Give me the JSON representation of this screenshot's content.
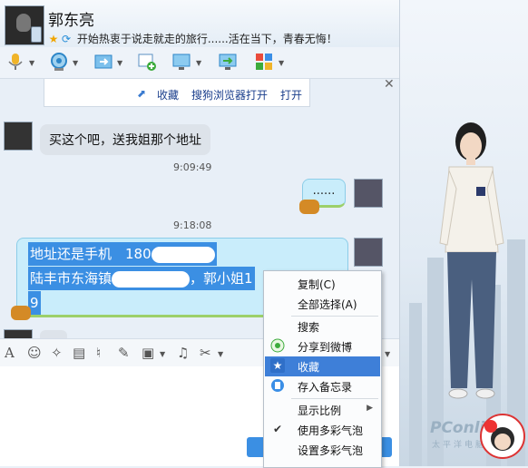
{
  "window": {
    "contact_name": "郭东亮",
    "signature": "开始热衷于说走就走的旅行......活在当下，青春无悔！",
    "controls": "— ☐ ✕"
  },
  "toolbar": {
    "icons": [
      "microphone-icon",
      "video-camera-icon",
      "send-file-icon",
      "create-discussion-icon",
      "remote-desktop-icon",
      "share-screen-icon",
      "app-grid-icon"
    ]
  },
  "link_bar": {
    "favorite": "收藏",
    "open_with_browser": "搜狗浏览器打开",
    "open": "打开"
  },
  "messages": {
    "m1_text": "买这个吧，送我姐那个地址",
    "time1": "9:09:49",
    "m2_text": "......",
    "time2": "9:18:08",
    "m3_line1": "地址还是手机　180",
    "m3_line2a": "陆丰市东海镇",
    "m3_line2b": "，郭小姐1",
    "m3_line3": "9"
  },
  "input_toolbar": {
    "icons": [
      "font-icon",
      "emoji-icon",
      "magic-wand-icon",
      "gif-icon",
      "voice-message-icon",
      "draw-icon",
      "image-icon",
      "music-icon",
      "screenshot-scissors-icon"
    ]
  },
  "context_menu": {
    "items": [
      {
        "label": "复制(C)"
      },
      {
        "label": "全部选择(A)"
      },
      {
        "label": "搜索"
      },
      {
        "label": "分享到微博"
      },
      {
        "label": "收藏"
      },
      {
        "label": "存入备忘录"
      },
      {
        "label": "显示比例"
      },
      {
        "label": "使用多彩气泡"
      },
      {
        "label": "设置多彩气泡"
      }
    ]
  },
  "watermark": {
    "brand": "PConline",
    "subtitle": "太平洋电脑网"
  },
  "colors": {
    "selection": "#3b8fe3",
    "menu_highlight": "#3e7fd8",
    "bubble_blue": "#c9edfb"
  }
}
